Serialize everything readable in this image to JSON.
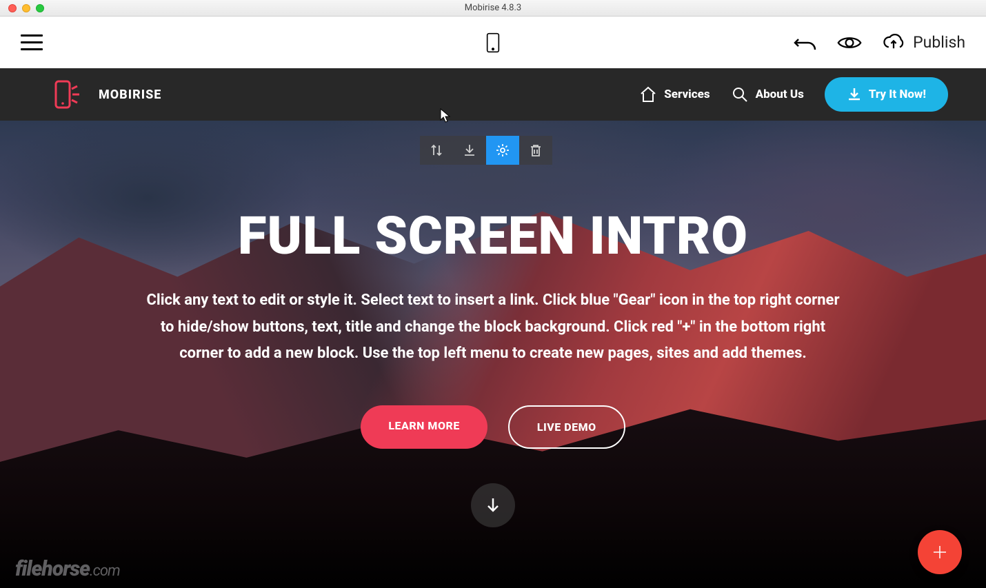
{
  "window": {
    "title": "Mobirise 4.8.3"
  },
  "toolbar": {
    "publish_label": "Publish"
  },
  "navbar": {
    "brand": "MOBIRISE",
    "items": [
      {
        "icon": "home-icon",
        "label": "Services"
      },
      {
        "icon": "search-icon",
        "label": "About Us"
      }
    ],
    "cta": {
      "icon": "download-icon",
      "label": "Try It Now!"
    }
  },
  "hero": {
    "title": "FULL SCREEN INTRO",
    "description": "Click any text to edit or style it. Select text to insert a link. Click blue \"Gear\" icon in the top right corner to hide/show buttons, text, title and change the block background. Click red \"+\" in the bottom right corner to add a new block. Use the top left menu to create new pages, sites and add themes.",
    "buttons": {
      "primary": "LEARN MORE",
      "secondary": "LIVE DEMO"
    }
  },
  "watermark": {
    "main": "filehorse",
    "suffix": ".com"
  },
  "colors": {
    "accent_pink": "#ef3b56",
    "accent_blue": "#1eb4e6",
    "fab_red": "#f44336",
    "gear_blue": "#2196f3",
    "navbar_bg": "#282828"
  }
}
